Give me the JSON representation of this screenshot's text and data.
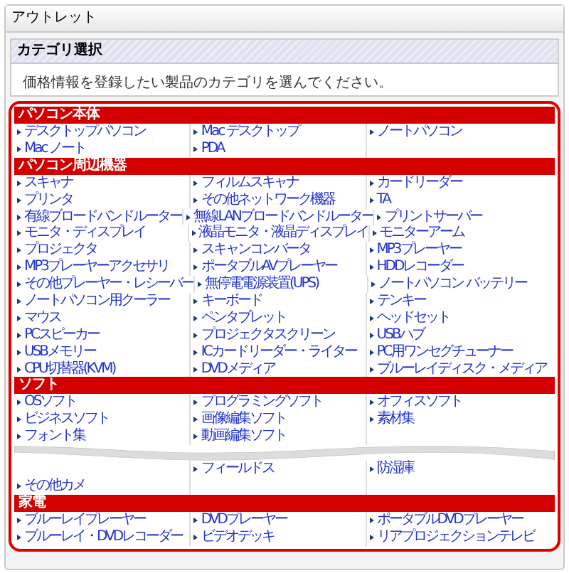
{
  "panel": {
    "title": "アウトレット"
  },
  "category_select": {
    "title": "カテゴリ選択",
    "instruction": "価格情報を登録したい製品のカテゴリを選んでください。"
  },
  "sections": [
    {
      "title": "パソコン本体",
      "rows": [
        [
          "デスクトップパソコン",
          "Mac デスクトップ",
          "ノートパソコン"
        ],
        [
          "Mac ノート",
          "PDA",
          null
        ]
      ]
    },
    {
      "title": "パソコン周辺機器",
      "rows": [
        [
          "スキャナ",
          "フィルムスキャナ",
          "カードリーダー"
        ],
        [
          "プリンタ",
          "その他ネットワーク機器",
          "TA"
        ],
        [
          "有線ブロードバンドルーター",
          "無線LANブロードバンドルーター",
          "プリントサーバー"
        ],
        [
          "モニタ・ディスプレイ",
          "液晶モニタ・液晶ディスプレイ",
          "モニターアーム"
        ],
        [
          "プロジェクタ",
          "スキャンコンバータ",
          "MP3プレーヤー"
        ],
        [
          "MP3プレーヤーアクセサリ",
          "ポータブルAVプレーヤー",
          "HDDレコーダー"
        ],
        [
          "その他プレーヤー・レシーバー",
          "無停電電源装置(UPS)",
          "ノートパソコン バッテリー"
        ],
        [
          "ノートパソコン用クーラー",
          "キーボード",
          "テンキー"
        ],
        [
          "マウス",
          "ペンタブレット",
          "ヘッドセット"
        ],
        [
          "PCスピーカー",
          "プロジェクタスクリーン",
          "USBハブ"
        ],
        [
          "USBメモリー",
          "ICカードリーダー・ライター",
          "PC用ワンセグチューナー"
        ],
        [
          "CPU切替器(KVM)",
          "DVDメディア",
          "ブルーレイディスク・メディア"
        ]
      ]
    },
    {
      "title": "ソフト",
      "rows": [
        [
          "OSソフト",
          "プログラミングソフト",
          "オフィスソフト"
        ],
        [
          "ビジネスソフト",
          "画像編集ソフト",
          "素材集"
        ],
        [
          "フォント集",
          "動画編集ソフト",
          null
        ],
        [
          null,
          "フィールドス",
          "防湿庫"
        ],
        [
          "その他カメ",
          null,
          null
        ]
      ]
    },
    {
      "title": "家電",
      "rows": [
        [
          "ブルーレイプレーヤー",
          "DVDプレーヤー",
          "ポータブルDVDプレーヤー"
        ],
        [
          "ブルーレイ・DVDレコーダー",
          "ビデオデッキ",
          "リアプロジェクションテレビ"
        ]
      ]
    }
  ]
}
